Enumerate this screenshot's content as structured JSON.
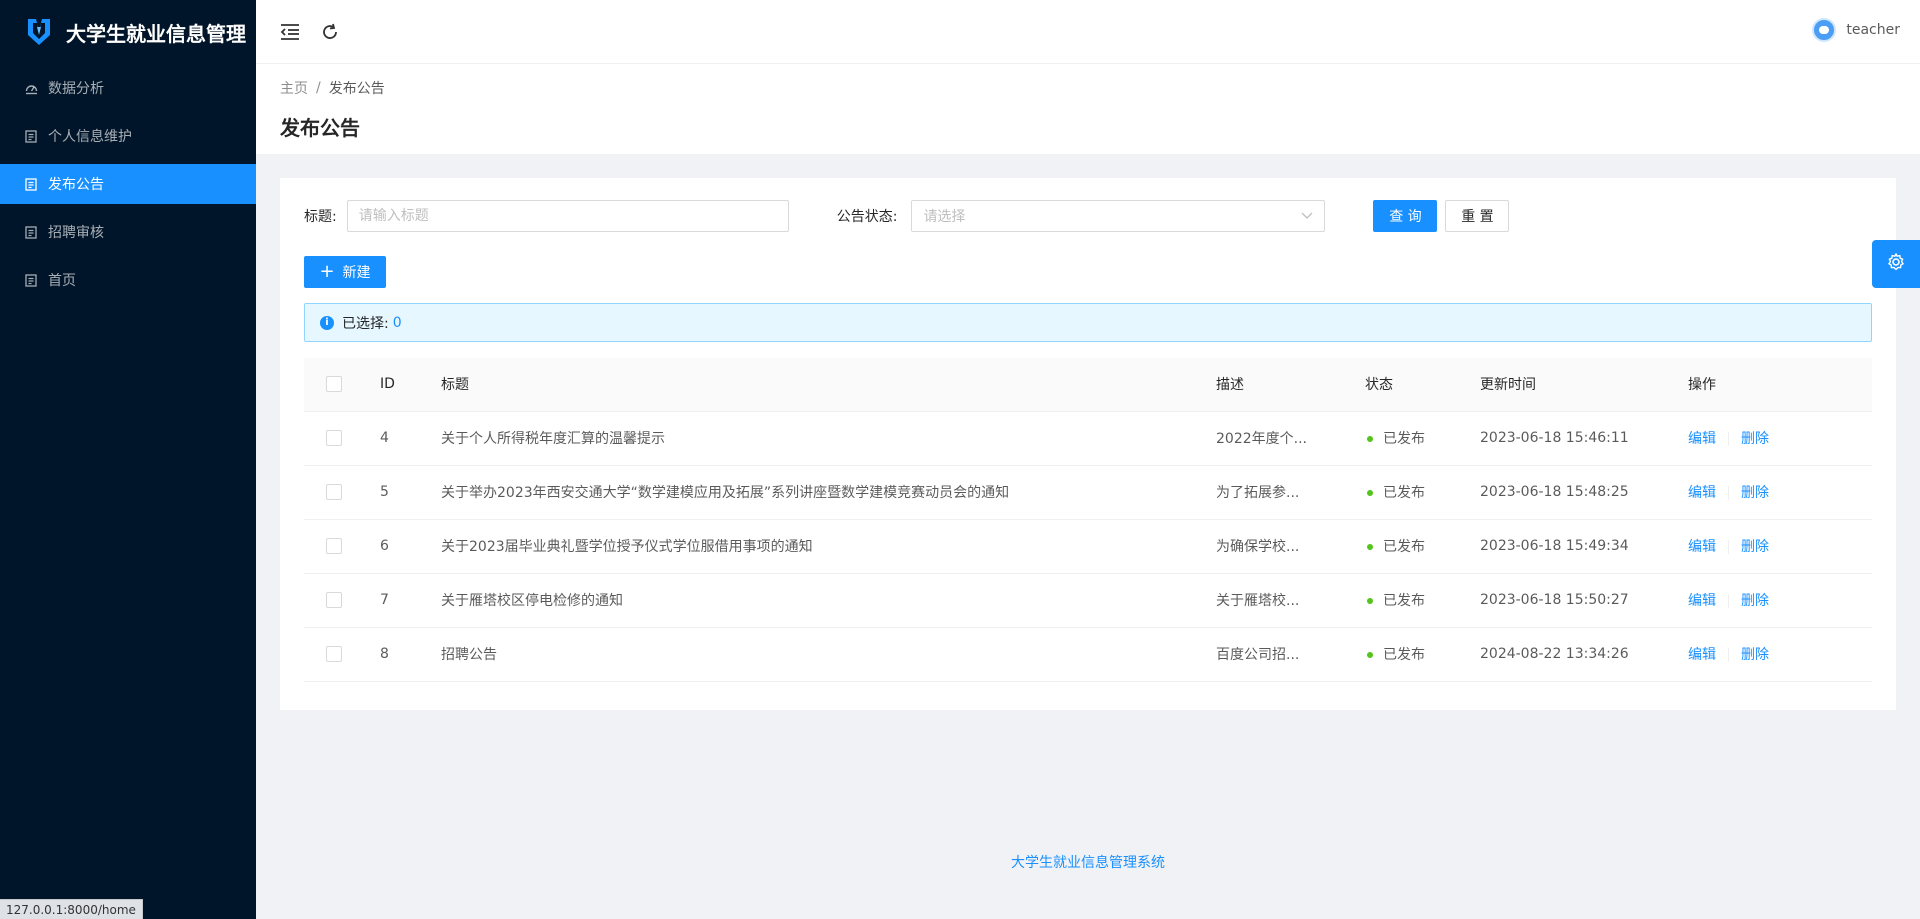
{
  "app": {
    "title": "大学生就业信息管理"
  },
  "sidebar": {
    "items": [
      {
        "label": "数据分析",
        "icon": "dashboard-icon",
        "active": false
      },
      {
        "label": "个人信息维护",
        "icon": "file-icon",
        "active": false
      },
      {
        "label": "发布公告",
        "icon": "file-icon",
        "active": true
      },
      {
        "label": "招聘审核",
        "icon": "file-icon",
        "active": false
      },
      {
        "label": "首页",
        "icon": "file-icon",
        "active": false
      }
    ]
  },
  "header": {
    "username": "teacher"
  },
  "breadcrumb": {
    "home": "主页",
    "separator": "/",
    "current": "发布公告"
  },
  "page": {
    "title": "发布公告"
  },
  "search": {
    "title_label": "标题:",
    "title_placeholder": "请输入标题",
    "status_label": "公告状态:",
    "status_placeholder": "请选择",
    "query_label": "查 询",
    "reset_label": "重 置"
  },
  "toolbar": {
    "new_label": "新建"
  },
  "selection": {
    "label": "已选择:",
    "count": "0"
  },
  "table": {
    "headers": {
      "id": "ID",
      "title": "标题",
      "desc": "描述",
      "status": "状态",
      "time": "更新时间",
      "ops": "操作"
    },
    "edit_label": "编辑",
    "delete_label": "删除",
    "rows": [
      {
        "id": "4",
        "title": "关于个人所得税年度汇算的温馨提示",
        "desc": "2022年度个...",
        "status": "已发布",
        "time": "2023-06-18 15:46:11"
      },
      {
        "id": "5",
        "title": "关于举办2023年西安交通大学“数学建模应用及拓展”系列讲座暨数学建模竞赛动员会的通知",
        "desc": "为了拓展参...",
        "status": "已发布",
        "time": "2023-06-18 15:48:25"
      },
      {
        "id": "6",
        "title": "关于2023届毕业典礼暨学位授予仪式学位服借用事项的通知",
        "desc": "为确保学校...",
        "status": "已发布",
        "time": "2023-06-18 15:49:34"
      },
      {
        "id": "7",
        "title": "关于雁塔校区停电检修的通知",
        "desc": "关于雁塔校...",
        "status": "已发布",
        "time": "2023-06-18 15:50:27"
      },
      {
        "id": "8",
        "title": "招聘公告",
        "desc": "百度公司招...",
        "status": "已发布",
        "time": "2024-08-22 13:34:26"
      }
    ]
  },
  "footer": {
    "text": "大学生就业信息管理系统"
  },
  "statusbar": {
    "url": "127.0.0.1:8000/home"
  },
  "colors": {
    "primary": "#1890ff",
    "sider": "#001529",
    "success": "#52c41a"
  }
}
